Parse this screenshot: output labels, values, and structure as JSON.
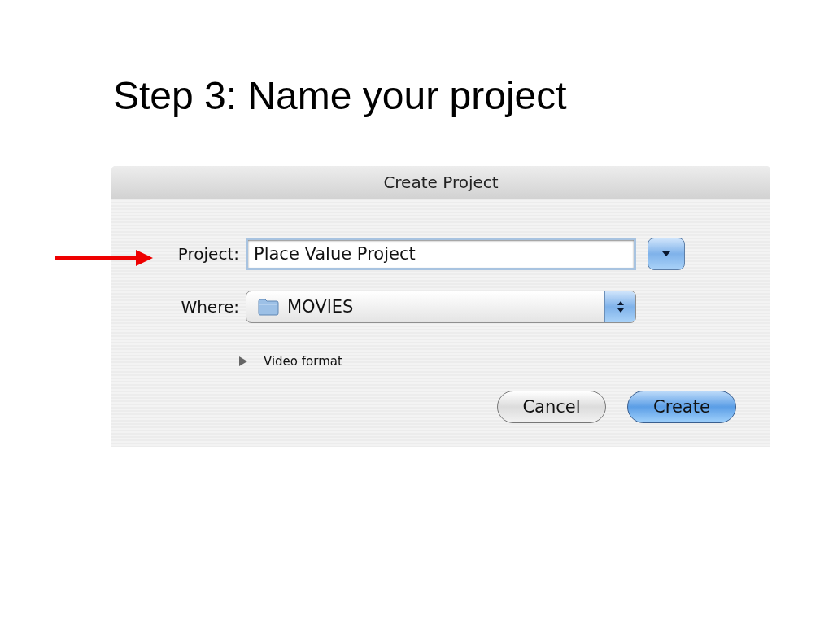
{
  "slide": {
    "title": "Step 3: Name your project"
  },
  "dialog": {
    "title": "Create Project",
    "project": {
      "label": "Project:",
      "value": "Place Value Project"
    },
    "where": {
      "label": "Where:",
      "value": "MOVIES"
    },
    "disclosure": {
      "label": "Video format",
      "expanded": false
    },
    "buttons": [
      {
        "label": "Cancel",
        "default": false
      },
      {
        "label": "Create",
        "default": true
      }
    ]
  }
}
